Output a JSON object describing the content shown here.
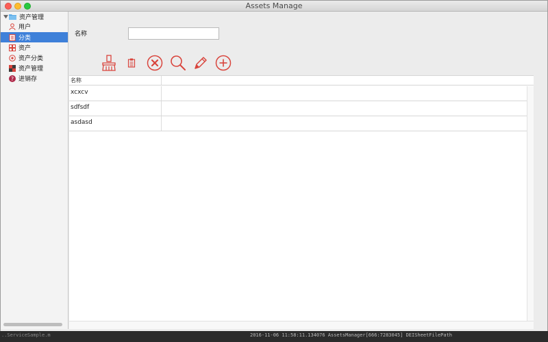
{
  "window": {
    "title": "Assets Manage"
  },
  "sidebar": {
    "items": [
      {
        "label": "资产管理",
        "icon": "folder-icon"
      },
      {
        "label": "用户",
        "icon": "user-icon"
      },
      {
        "label": "分类",
        "icon": "list-icon",
        "selected": true
      },
      {
        "label": "资产",
        "icon": "grid-icon"
      },
      {
        "label": "资产分类",
        "icon": "category-icon"
      },
      {
        "label": "资产管理",
        "icon": "puzzle-icon"
      },
      {
        "label": "进销存",
        "icon": "question-icon"
      }
    ]
  },
  "form": {
    "name_label": "名称",
    "name_value": "",
    "name_placeholder": ""
  },
  "toolbar": {
    "buttons": [
      "clear-broom-icon",
      "clipboard-icon",
      "delete-circle-x-icon",
      "search-icon",
      "edit-pencil-icon",
      "add-circle-plus-icon"
    ],
    "accent": "#d9443c"
  },
  "table": {
    "columns": [
      "名称",
      ""
    ],
    "rows": [
      {
        "name": "xcxcv"
      },
      {
        "name": "sdfsdf"
      },
      {
        "name": "asdasd"
      }
    ]
  },
  "background_log": {
    "left": "..ServiceSample.m",
    "right": "2016-11-06 11:58:11.134076 AssetsManager[666:7283045] DEISheetFilePath"
  }
}
